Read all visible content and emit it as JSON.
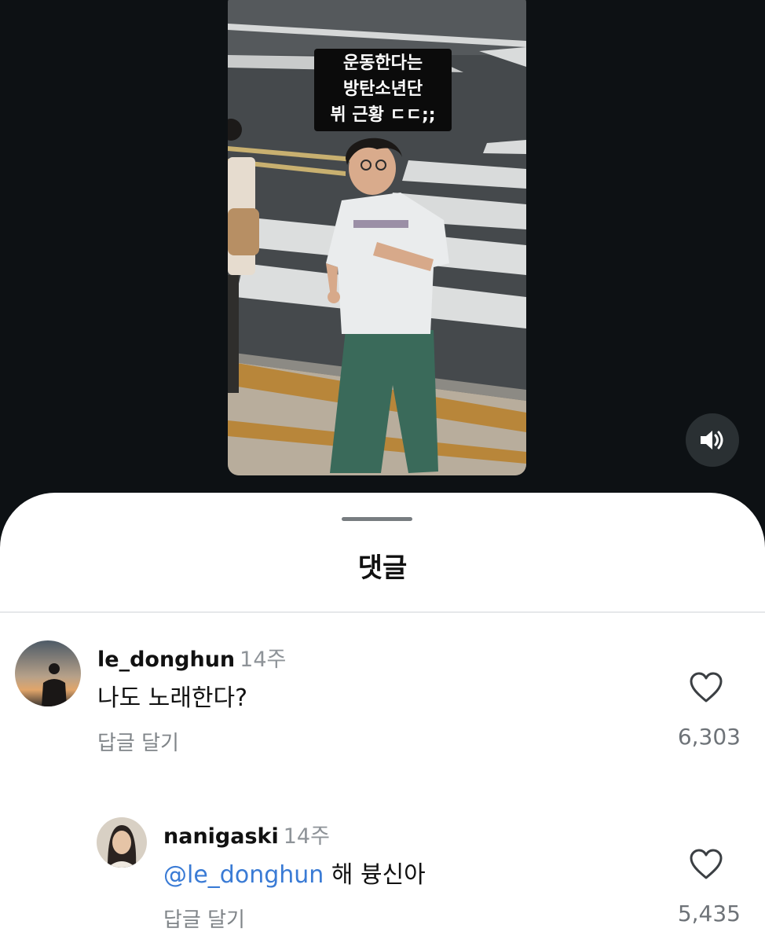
{
  "video": {
    "caption_lines": [
      "운동한다는",
      "방탄소년단",
      "뷔 근황 ㄷㄷ;;"
    ],
    "volume_icon": "speaker-icon"
  },
  "comments_sheet": {
    "title": "댓글",
    "comments": [
      {
        "username": "le_donghun",
        "time": "14주",
        "text": "나도 노래한다?",
        "reply_label": "답글 달기",
        "like_icon": "heart-icon",
        "likes": "6,303"
      },
      {
        "username": "nanigaski",
        "time": "14주",
        "mention": "@le_donghun",
        "text": "해 븅신아",
        "reply_label": "답글 달기",
        "like_icon": "heart-icon",
        "likes": "5,435"
      }
    ]
  },
  "colors": {
    "background": "#0d1114",
    "sheet": "#ffffff",
    "mention": "#3a7bd5",
    "muted_text": "#8e9398"
  }
}
